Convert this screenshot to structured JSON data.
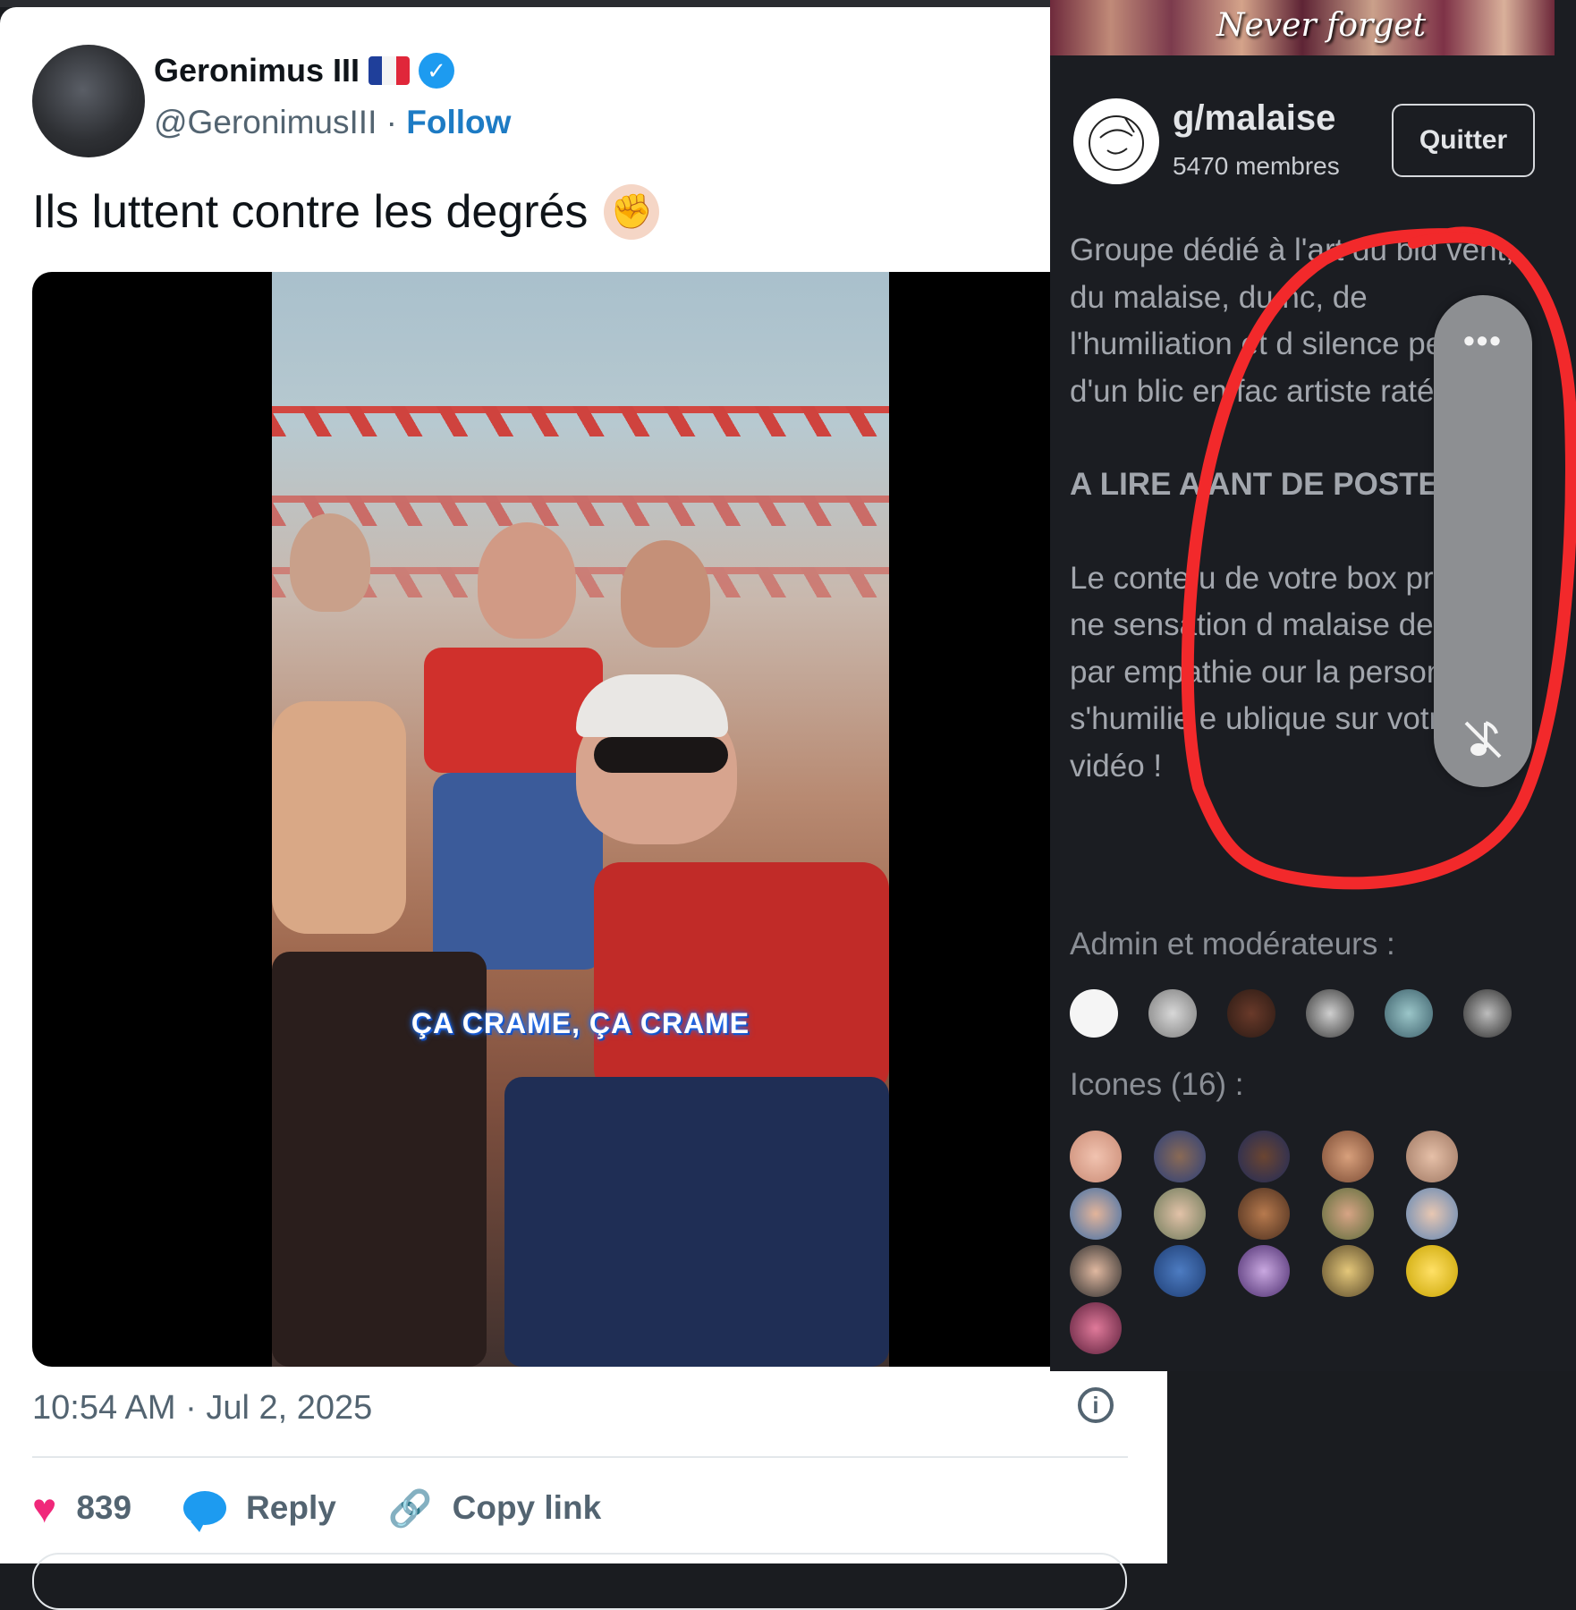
{
  "tweet": {
    "author_name": "Geronimus III",
    "author_handle": "@GeronimusIII",
    "separator": "·",
    "follow_label": "Follow",
    "text": "Ils luttent contre les degrés",
    "video_caption": "ÇA CRAME, ÇA CRAME",
    "timestamp": "10:54 AM · Jul 2, 2025",
    "like_count": "839",
    "reply_label": "Reply",
    "copy_link_label": "Copy link",
    "icons": {
      "verified": "verified-badge-icon",
      "flag": "france-flag-icon",
      "emoji": "raised-fist-emoji",
      "info": "info-icon",
      "like": "heart-icon",
      "reply": "speech-bubble-icon",
      "copy": "link-icon"
    }
  },
  "group": {
    "banner_text": "Never forget",
    "name": "g/malaise",
    "members": "5470 membres",
    "quit_label": "Quitter",
    "description_lines": [
      "Groupe dédié à l'art du bid",
      "vent, du malaise, du",
      "nc, de",
      "l'humiliation et d",
      "silence",
      "pesant d'un p",
      "blic en fac",
      "artiste raté"
    ],
    "description_text": "Groupe dédié à l'art du bid vent, du malaise, du nc, de l'humiliation et d silence pesant d'un blic en fac artiste raté",
    "rule_heading": "A LIRE A ANT DE POSTE",
    "rule_text": "Le conte u de votre box procurer ne sensation d malaise de honte par empathie our la personn s'humilie e ublique sur votre vidéo !",
    "admins_label": "Admin et modérateurs :",
    "icons_label": "Icones (16) :",
    "admin_count": 6,
    "icon_count": 16
  },
  "floating_control": {
    "more_label": "•••",
    "icons": [
      "more-options-icon",
      "music-off-icon"
    ]
  },
  "colors": {
    "follow": "#1d7bc4",
    "verified": "#1d9bf0",
    "heart": "#f0287a",
    "panel_bg": "#1b1d22",
    "annotation": "#f2292b"
  }
}
